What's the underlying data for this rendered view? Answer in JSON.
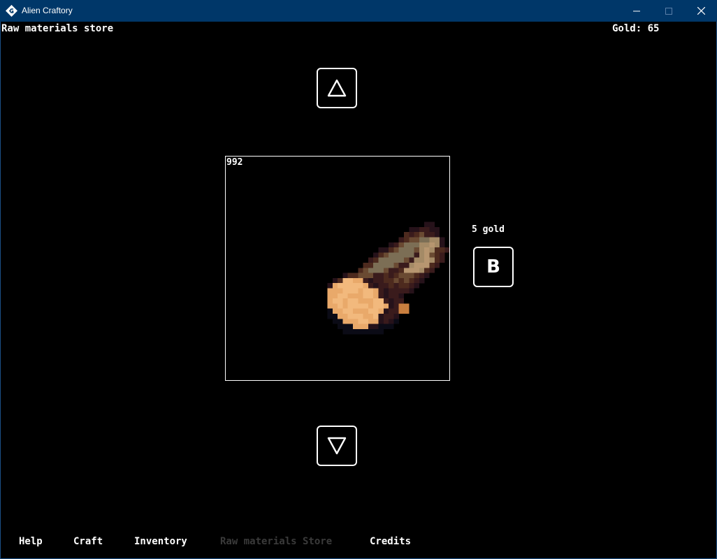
{
  "window": {
    "title": "Alien Craftory",
    "icons": {
      "app": "app-icon",
      "minimize": "minimize-icon",
      "maximize": "maximize-icon",
      "close": "close-icon"
    }
  },
  "header": {
    "screen_title": "Raw materials store",
    "gold_label": "Gold: 65"
  },
  "store": {
    "item_count": "992",
    "item_icon": "wood-log-icon",
    "price": "5 gold",
    "buy_label": "B",
    "prev_icon": "triangle-up-icon",
    "next_icon": "triangle-down-icon"
  },
  "nav": {
    "items": [
      {
        "label": "Help",
        "active": true
      },
      {
        "label": "Craft",
        "active": true
      },
      {
        "label": "Inventory",
        "active": true
      },
      {
        "label": "Raw materials Store",
        "active": false
      },
      {
        "label": "Credits",
        "active": true
      }
    ]
  },
  "colors": {
    "titlebar": "#003769",
    "background": "#000000",
    "text": "#ffffff",
    "nav_inactive": "#3a3a3a"
  }
}
